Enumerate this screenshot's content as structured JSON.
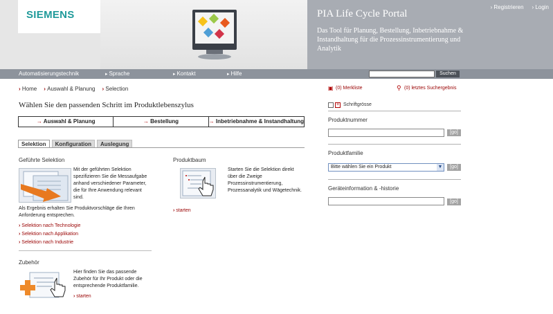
{
  "header": {
    "logo": "SIEMENS",
    "portal_title": "PIA Life Cycle Portal",
    "portal_subtitle": "Das Tool für Planung, Bestellung, Inbetriebnahme & Instandhaltung für die Prozessinstrumentierung und Analytik",
    "links": {
      "register": "Registrieren",
      "login": "Login"
    }
  },
  "nav": {
    "items": [
      "Automatisierungstechnik",
      "Sprache",
      "Kontakt",
      "Hilfe"
    ],
    "search_placeholder": "",
    "search_button": "Suchen"
  },
  "breadcrumb": [
    "Home",
    "Auswahl & Planung",
    "Selection"
  ],
  "page_title": "Wählen Sie den passenden Schritt im Produktlebenszylus",
  "steps": [
    "Auswahl & Planung",
    "Bestellung",
    "Inbetriebnahme & Instandhaltung"
  ],
  "tabs": [
    "Selektion",
    "Konfiguration",
    "Auslegung"
  ],
  "guided": {
    "title": "Geführte Selektion",
    "description": "Mit der geführten Selektion spezifizieren Sie die Messaufgabe anhand verschiedener Parameter, die für Ihre Anwendung relevant sind.",
    "description_cont": "Als Ergebnis erhalten Sie Produktvorschläge die Ihren Anforderung entsprechen.",
    "links": [
      "Selektion nach Technologie",
      "Selektion nach Applikation",
      "Selektion nach Industrie"
    ]
  },
  "product_tree": {
    "title": "Produktbaum",
    "description": "Starten Sie die Selektion direkt über die Zweige Prozessinstrumentierung, Prozessanalytik und Wägetechnik.",
    "link": "starten"
  },
  "accessories": {
    "title": "Zubehör",
    "description": "Hier finden Sie das passende Zubehör für Ihr Produkt oder die entsprechende Produktfamilie.",
    "link": "starten"
  },
  "right_panel": {
    "watchlist": "(0) Merkliste",
    "last_results": "(0) letztes Suchergebnis",
    "font_size_label": "Schriftgrösse",
    "product_number_label": "Produktnummer",
    "product_family_label": "Produktfamilie",
    "product_family_selected": "Bitte wählen Sie ein Produkt",
    "device_info_label": "Geräteinformation & -historie",
    "go_label": "[go]"
  },
  "colors": {
    "accent": "#990000",
    "brand": "#1f9a9a",
    "nav_bg": "#8d939c"
  }
}
